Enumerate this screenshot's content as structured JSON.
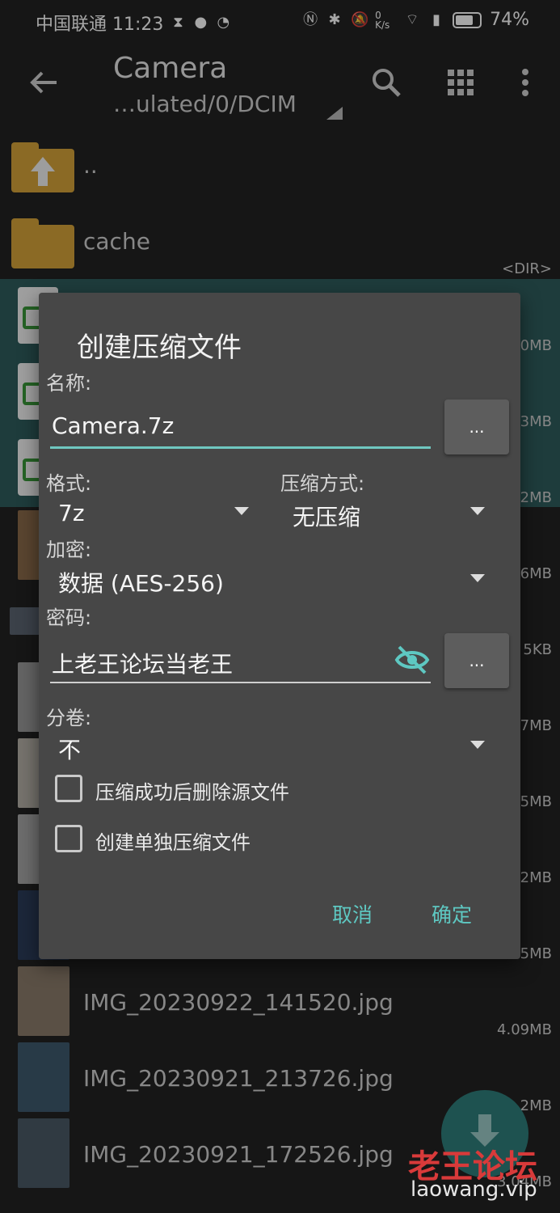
{
  "status_bar": {
    "carrier_time": "中国联通 11:23",
    "net_speed": "0 K/s",
    "battery": "74%",
    "battery_level": 0.74
  },
  "appbar": {
    "title": "Camera",
    "path": "…ulated/0/DCIM"
  },
  "files": [
    {
      "name": "..",
      "size": ""
    },
    {
      "name": "cache",
      "size": "<DIR>"
    },
    {
      "name": "",
      "size": "0MB"
    },
    {
      "name": "",
      "size": "3MB"
    },
    {
      "name": "",
      "size": "2MB"
    },
    {
      "name": "",
      "size": "6MB"
    },
    {
      "name": "",
      "size": "5KB"
    },
    {
      "name": "",
      "size": "7MB"
    },
    {
      "name": "",
      "size": "5MB"
    },
    {
      "name": "",
      "size": "2MB"
    },
    {
      "name": "",
      "size": "5MB"
    },
    {
      "name": "IMG_20230922_141520.jpg",
      "size": "4.09MB"
    },
    {
      "name": "IMG_20230921_213726.jpg",
      "size": "2MB"
    },
    {
      "name": "IMG_20230921_172526.jpg",
      "size": "3.04MB"
    }
  ],
  "dialog": {
    "title": "创建压缩文件",
    "name_label": "名称:",
    "name_value": "Camera.7z",
    "dots": "...",
    "format_label": "格式:",
    "format_value": "7z",
    "method_label": "压缩方式:",
    "method_value": "无压缩",
    "encrypt_label": "加密:",
    "encrypt_value": "数据 (AES-256)",
    "password_label": "密码:",
    "password_value": "上老王论坛当老王",
    "split_label": "分卷:",
    "split_value": "不",
    "checkbox_delete": "压缩成功后删除源文件",
    "checkbox_separate": "创建单独压缩文件",
    "cancel": "取消",
    "ok": "确定"
  },
  "watermark": {
    "title": "老王论坛",
    "url": "laowang.vip"
  },
  "colors": {
    "accent": "#5ec8c2",
    "selected_row": "#2f5d5c",
    "folder": "#d6a33a",
    "dialog_bg": "#474747"
  }
}
